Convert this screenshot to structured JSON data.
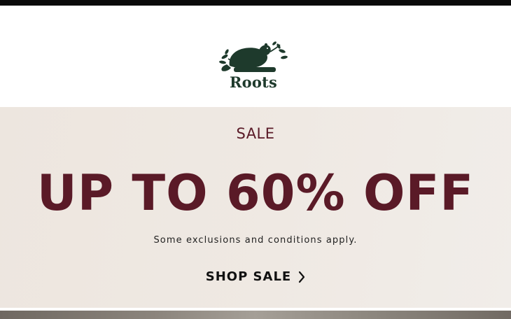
{
  "brand": {
    "name": "Roots",
    "icon": "beaver-logo-icon",
    "color": "#1e3a2c"
  },
  "hero": {
    "eyebrow": "SALE",
    "headline": "UP TO 60% OFF",
    "disclaimer": "Some exclusions and conditions apply.",
    "cta_label": "SHOP SALE",
    "cta_icon": "chevron-right-icon",
    "accent_color": "#5a1a27"
  }
}
